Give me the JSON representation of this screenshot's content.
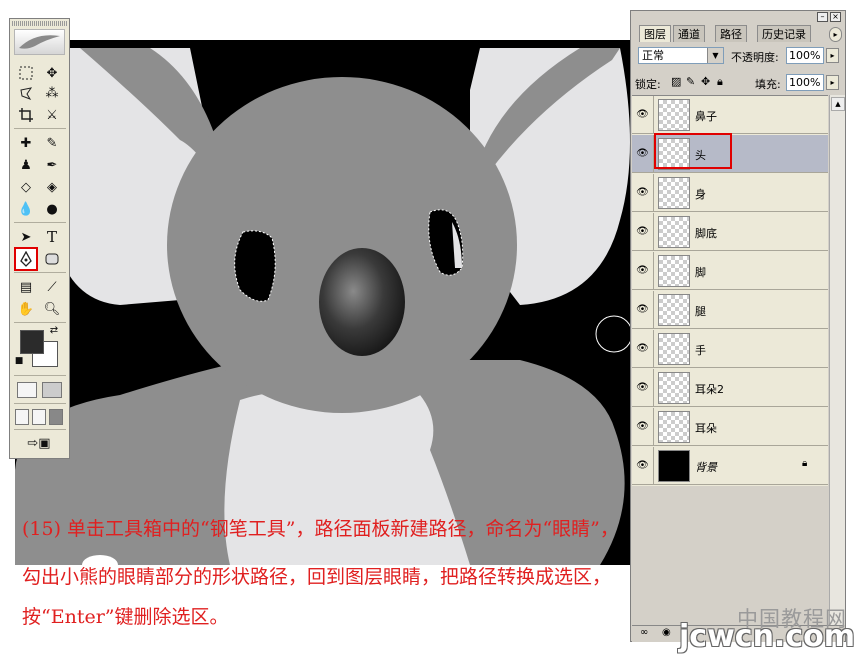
{
  "toolbox": {
    "tools": [
      "marquee-tool",
      "move-tool",
      "lasso-tool",
      "magic-wand-tool",
      "crop-tool",
      "slice-tool",
      "healing-brush-tool",
      "brush-tool",
      "clone-stamp-tool",
      "history-brush-tool",
      "eraser-tool",
      "paint-bucket-tool",
      "blur-tool",
      "dodge-tool",
      "path-selection-tool",
      "type-tool",
      "pen-tool",
      "shape-tool",
      "notes-tool",
      "eyedropper-tool",
      "hand-tool",
      "zoom-tool"
    ],
    "selected_tool": "pen-tool",
    "type_tool_glyph": "T",
    "foreground_color": "#2b2b2b",
    "background_color": "#ffffff"
  },
  "layers_panel": {
    "tabs": [
      "图层",
      "通道",
      "路径",
      "历史记录"
    ],
    "active_tab": "图层",
    "blend_mode": "正常",
    "opacity_label": "不透明度:",
    "opacity_value": "100%",
    "lock_label": "锁定:",
    "fill_label": "填充:",
    "fill_value": "100%",
    "layers": [
      {
        "name": "鼻子",
        "selected": false
      },
      {
        "name": "头",
        "selected": true
      },
      {
        "name": "身",
        "selected": false
      },
      {
        "name": "脚底",
        "selected": false
      },
      {
        "name": "脚",
        "selected": false
      },
      {
        "name": "腿",
        "selected": false
      },
      {
        "name": "手",
        "selected": false
      },
      {
        "name": "耳朵2",
        "selected": false
      },
      {
        "name": "耳朵",
        "selected": false
      },
      {
        "name": "背景",
        "selected": false,
        "locked": true
      }
    ]
  },
  "instructions": {
    "line1": "(15) 单击工具箱中的“钢笔工具”，路径面板新建路径，命名为“眼睛”，",
    "line2": "勾出小熊的眼睛部分的形状路径，回到图层眼睛，把路径转换成选区，",
    "line3": "按“Enter”键删除选区。"
  },
  "watermark": {
    "site_cn": "中国教程网",
    "site_url": "jcwcn.com"
  },
  "colors": {
    "highlight": "#e00000",
    "instruction_text": "#e02020",
    "koala_gray": "#8e8e8e",
    "ear_light": "#e4e4e6"
  }
}
